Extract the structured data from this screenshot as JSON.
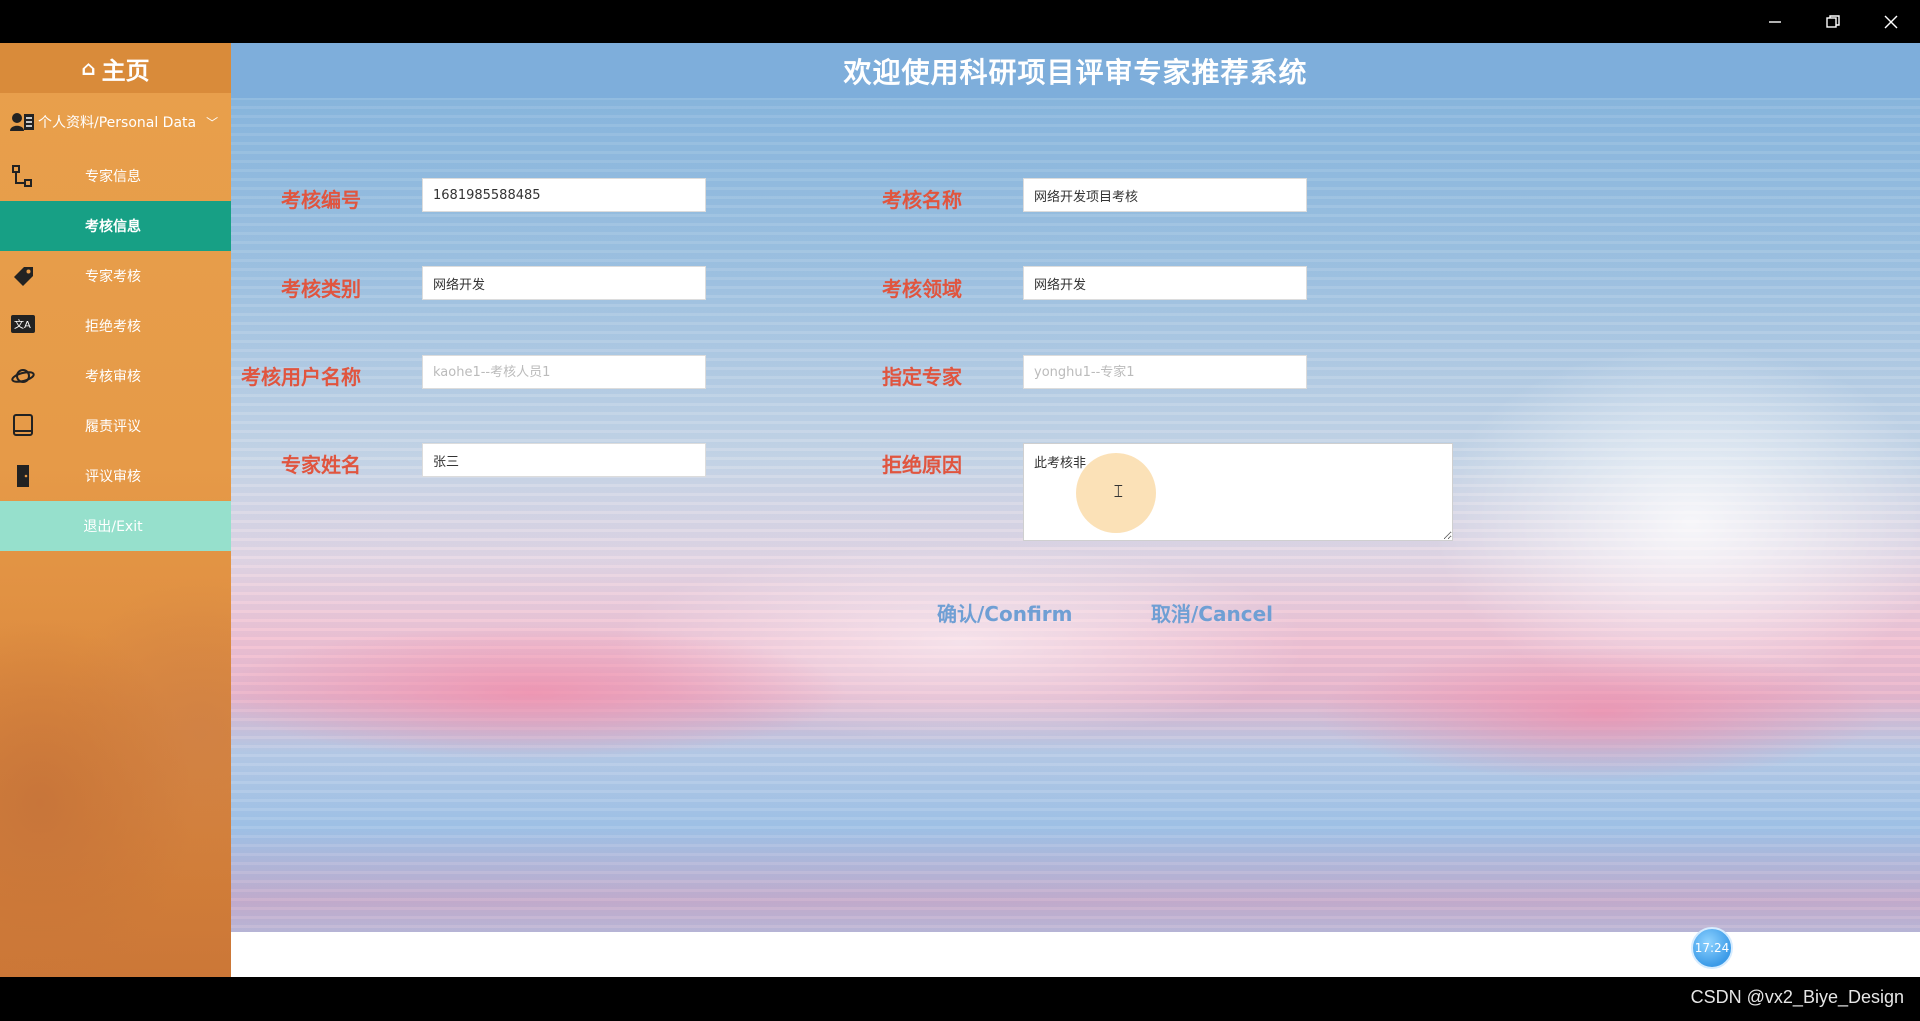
{
  "window": {
    "minimize_icon": "minimize-icon",
    "restore_icon": "restore-icon",
    "close_icon": "close-icon"
  },
  "sidebar": {
    "home_label": "主页",
    "personal_label": "个人资料/Personal Data",
    "items": [
      {
        "label": "专家信息",
        "icon": "hierarchy-icon"
      },
      {
        "label": "考核信息",
        "icon": "none",
        "active": true
      },
      {
        "label": "专家考核",
        "icon": "tag-icon"
      },
      {
        "label": "拒绝考核",
        "icon": "translate-icon"
      },
      {
        "label": "考核审核",
        "icon": "planet-icon"
      },
      {
        "label": "履责评议",
        "icon": "book-icon"
      },
      {
        "label": "评议审核",
        "icon": "door-icon"
      }
    ],
    "exit_label": "退出/Exit"
  },
  "header": {
    "title": "欢迎使用科研项目评审专家推荐系统"
  },
  "form": {
    "exam_id": {
      "label": "考核编号",
      "value": "1681985588485"
    },
    "exam_name": {
      "label": "考核名称",
      "value": "网络开发项目考核"
    },
    "exam_type": {
      "label": "考核类别",
      "value": "网络开发"
    },
    "exam_field": {
      "label": "考核领域",
      "value": "网络开发"
    },
    "exam_user": {
      "label": "考核用户名称",
      "placeholder": "kaohe1--考核人员1"
    },
    "assigned_expert": {
      "label": "指定专家",
      "placeholder": "yonghu1--专家1"
    },
    "expert_name": {
      "label": "专家姓名",
      "value": "张三"
    },
    "reject_reason": {
      "label": "拒绝原因",
      "value": "此考核非"
    }
  },
  "actions": {
    "confirm_label": "确认/Confirm",
    "cancel_label": "取消/Cancel"
  },
  "clock": {
    "time": "17:24"
  },
  "watermark": "CSDN @vx2_Biye_Design"
}
